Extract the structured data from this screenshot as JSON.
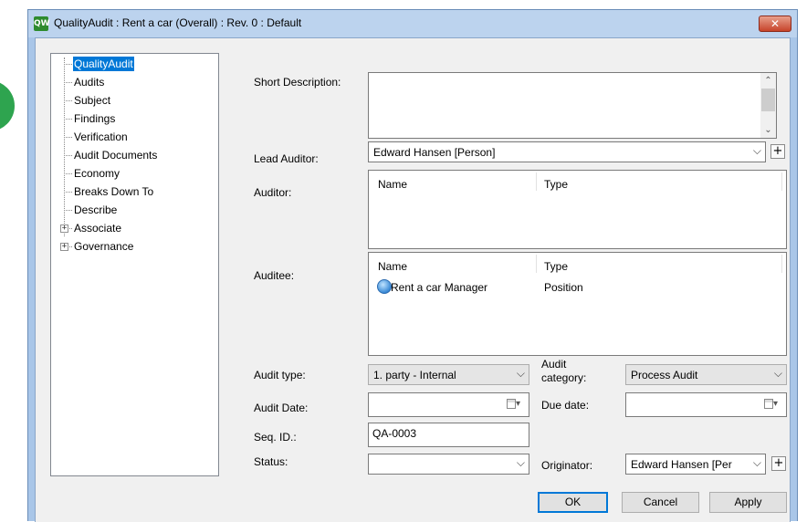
{
  "window": {
    "title": "QualityAudit : Rent a car (Overall) : Rev. 0  : Default",
    "app_icon_text": "QW",
    "close_glyph": "✕"
  },
  "tree": {
    "items": [
      {
        "label": "QualityAudit",
        "selected": true,
        "expandable": false
      },
      {
        "label": "Audits",
        "selected": false,
        "expandable": false
      },
      {
        "label": "Subject",
        "selected": false,
        "expandable": false
      },
      {
        "label": "Findings",
        "selected": false,
        "expandable": false
      },
      {
        "label": "Verification",
        "selected": false,
        "expandable": false
      },
      {
        "label": "Audit Documents",
        "selected": false,
        "expandable": false
      },
      {
        "label": "Economy",
        "selected": false,
        "expandable": false
      },
      {
        "label": "Breaks Down To",
        "selected": false,
        "expandable": false
      },
      {
        "label": "Describe",
        "selected": false,
        "expandable": false
      },
      {
        "label": "Associate",
        "selected": false,
        "expandable": true
      },
      {
        "label": "Governance",
        "selected": false,
        "expandable": true
      }
    ],
    "expander_glyph": "+"
  },
  "form": {
    "short_description": {
      "label": "Short Description:",
      "value": ""
    },
    "lead_auditor": {
      "label": "Lead Auditor:",
      "value": "Edward Hansen [Person]"
    },
    "auditor": {
      "label": "Auditor:",
      "columns": [
        "Name",
        "Type"
      ],
      "rows": []
    },
    "auditee": {
      "label": "Auditee:",
      "columns": [
        "Name",
        "Type"
      ],
      "rows": [
        {
          "name": "Rent a car Manager",
          "type": "Position",
          "icon": "position-icon"
        }
      ]
    },
    "audit_type": {
      "label": "Audit type:",
      "value": "1. party - Internal"
    },
    "audit_category": {
      "label_line1": "Audit",
      "label_line2": "category:",
      "value": "Process Audit"
    },
    "audit_date": {
      "label": "Audit Date:",
      "value": ""
    },
    "due_date": {
      "label": "Due date:",
      "value": ""
    },
    "seq_id": {
      "label": "Seq. ID.:",
      "value": "QA-0003"
    },
    "status": {
      "label": "Status:",
      "value": ""
    },
    "originator": {
      "label": "Originator:",
      "value": "Edward Hansen [Per"
    }
  },
  "glyphs": {
    "combo_arrow": "⌵",
    "plus": "+",
    "scroll_up": "⌃",
    "scroll_down": "⌄",
    "dropdown_small": "▾"
  },
  "buttons": {
    "ok": "OK",
    "cancel": "Cancel",
    "apply": "Apply"
  },
  "colors": {
    "selection": "#0078d7",
    "title_bar": "#bcd3ee",
    "close_button": "#c7432a"
  }
}
